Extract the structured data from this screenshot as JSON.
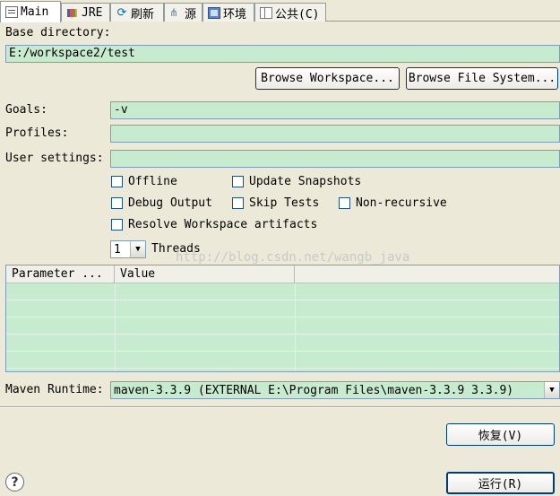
{
  "tabs": [
    {
      "label": "Main",
      "icon": "main-tab-icon",
      "active": true
    },
    {
      "label": "JRE",
      "icon": "jre-icon"
    },
    {
      "label": "刷新",
      "icon": "refresh-icon"
    },
    {
      "label": "源",
      "icon": "source-icon"
    },
    {
      "label": "环境",
      "icon": "environment-icon"
    },
    {
      "label": "公共(C)",
      "icon": "common-icon"
    }
  ],
  "base_directory": {
    "label": "Base directory:",
    "value": "E:/workspace2/test",
    "browse_workspace": "Browse Workspace...",
    "browse_file_system": "Browse File System..."
  },
  "goals": {
    "label": "Goals:",
    "value": "-v"
  },
  "profiles": {
    "label": "Profiles:",
    "value": ""
  },
  "user_settings": {
    "label": "User settings:",
    "value": ""
  },
  "options": {
    "offline": "Offline",
    "update_snapshots": "Update Snapshots",
    "debug_output": "Debug Output",
    "skip_tests": "Skip Tests",
    "non_recursive": "Non-recursive",
    "resolve_workspace": "Resolve Workspace artifacts"
  },
  "threads": {
    "value": "1",
    "label": "Threads"
  },
  "params_table": {
    "columns": [
      "Parameter ...",
      "Value"
    ]
  },
  "runtime": {
    "label": "Maven Runtime:",
    "value": "maven-3.3.9 (EXTERNAL E:\\Program Files\\maven-3.3.9 3.3.9)"
  },
  "watermark": "http://blog.csdn.net/wangb_java",
  "buttons": {
    "revert": "恢复(V)",
    "run": "运行(R)"
  }
}
